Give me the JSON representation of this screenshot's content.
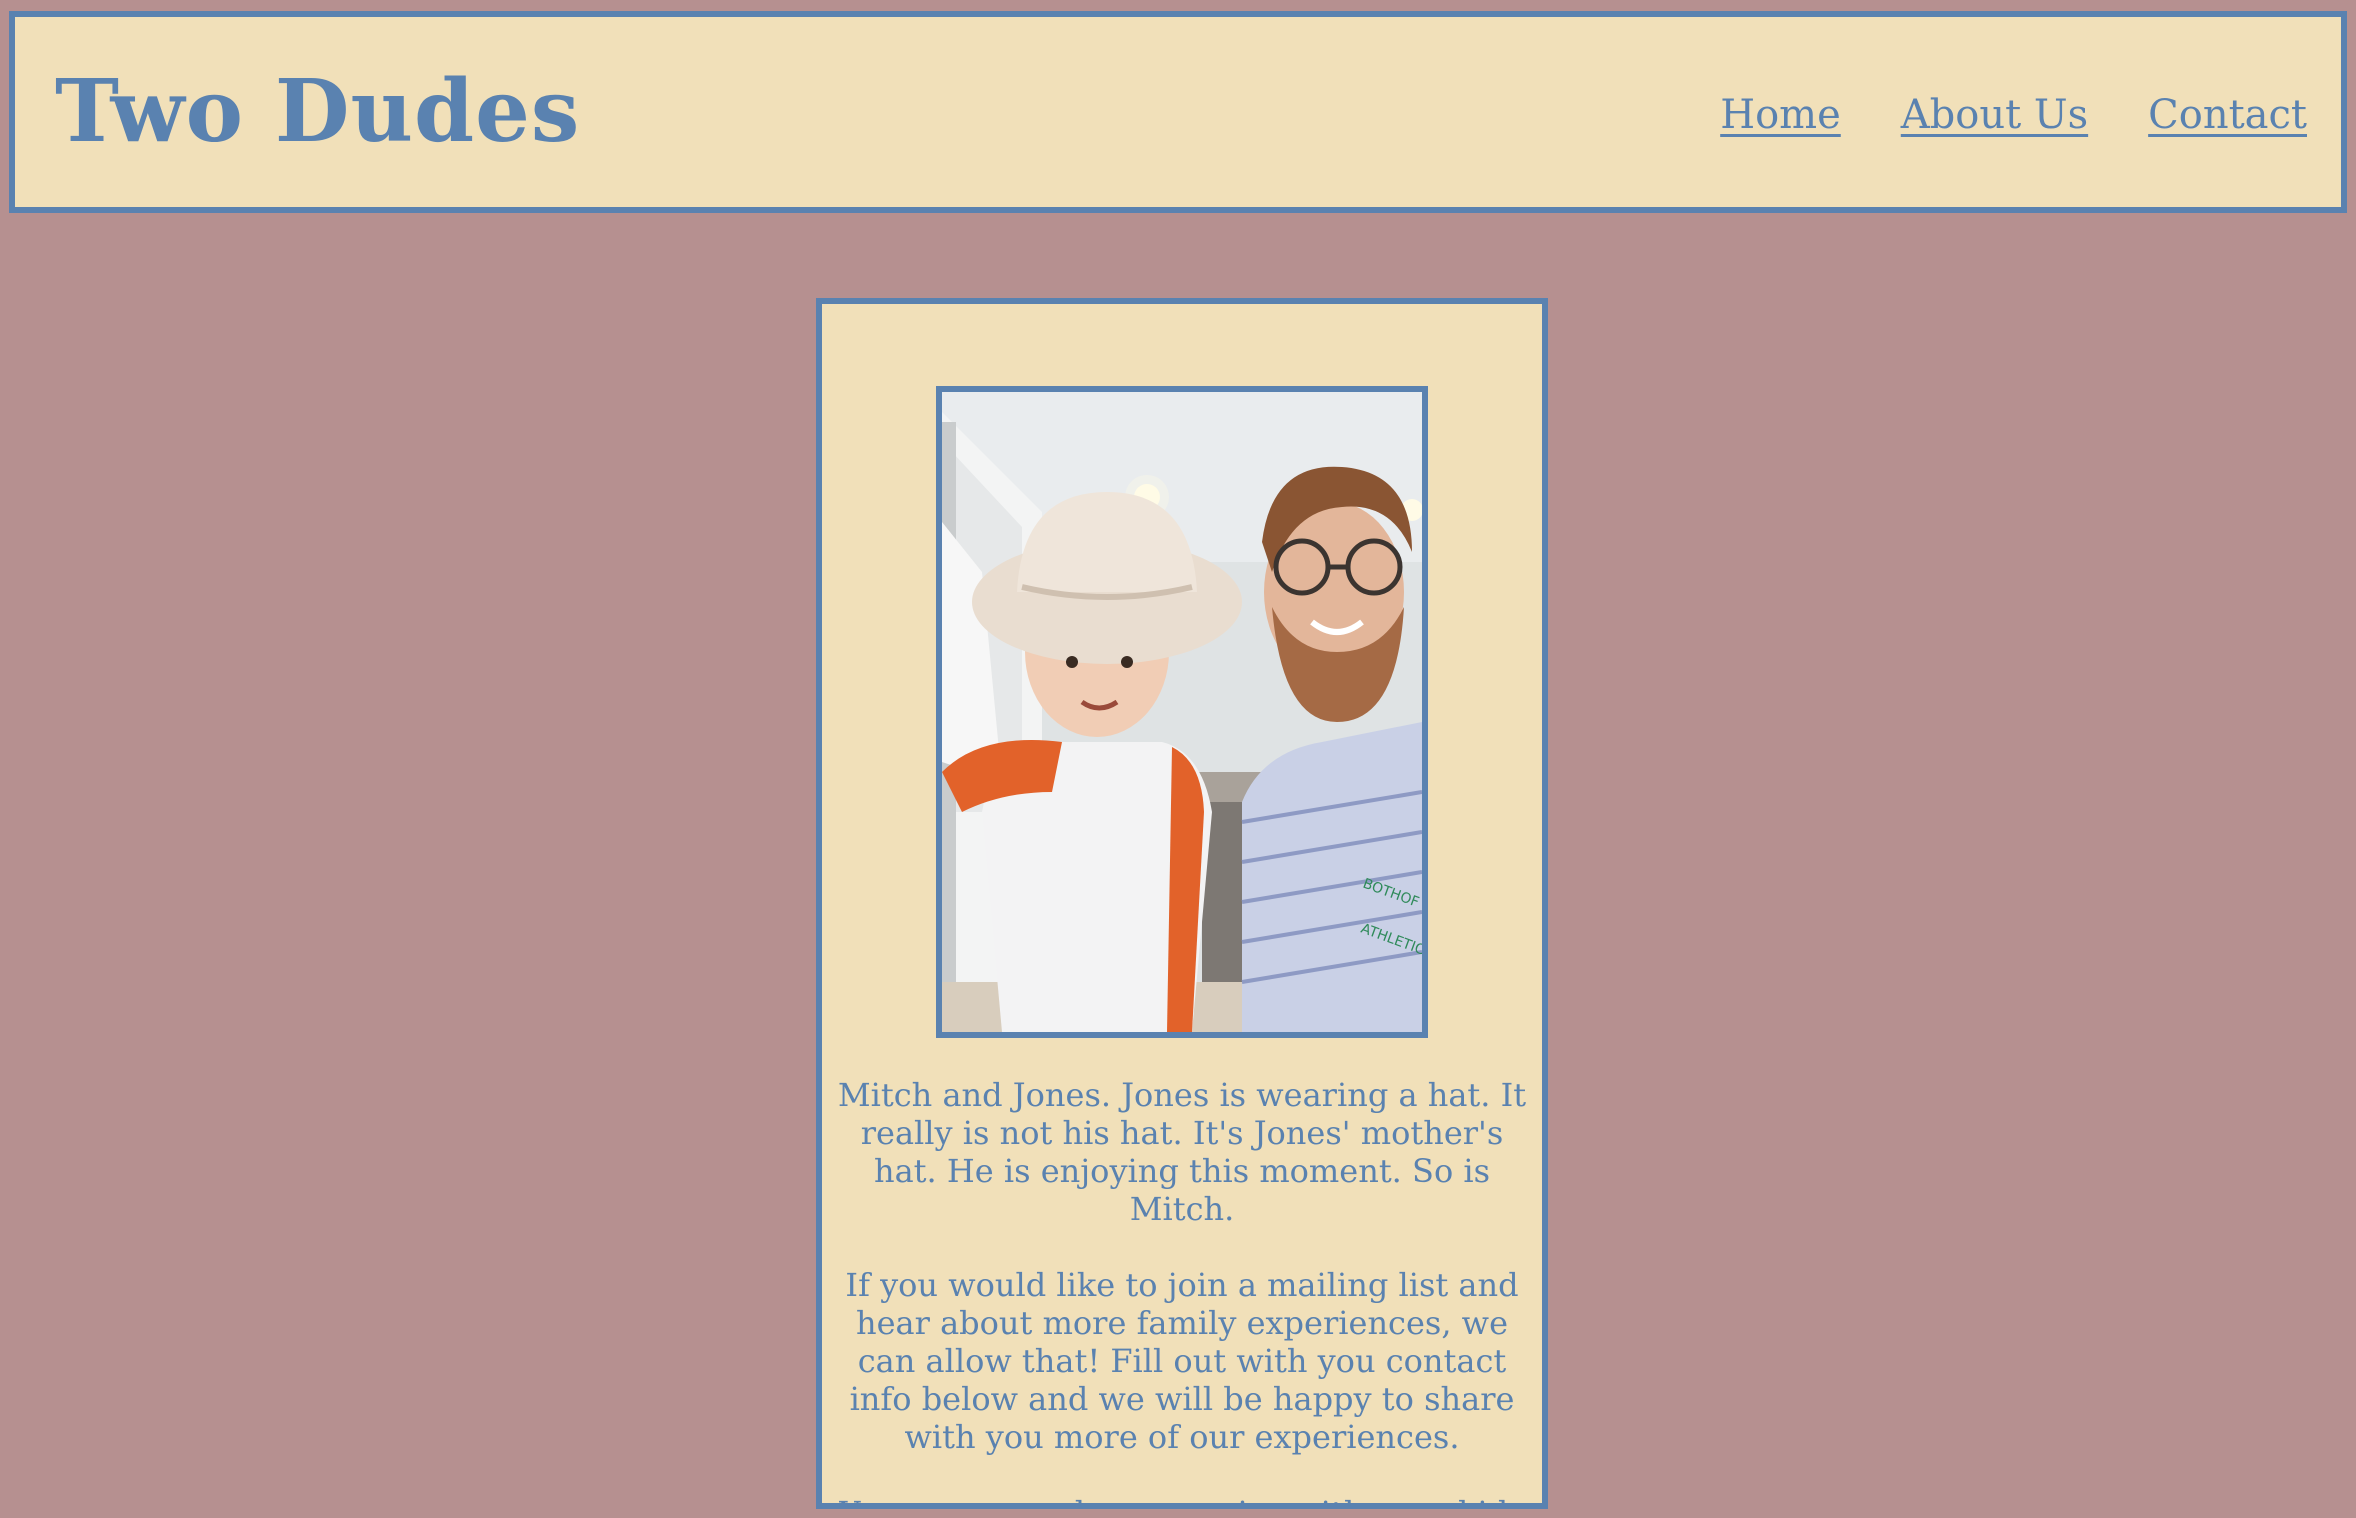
{
  "header": {
    "title": "Two Dudes",
    "nav": [
      {
        "label": "Home"
      },
      {
        "label": "About Us"
      },
      {
        "label": "Contact"
      }
    ]
  },
  "card": {
    "photo": {
      "shirt_text_1": "BOTHOF",
      "shirt_text_2": "ATHLETIC"
    },
    "paragraphs": [
      "Mitch and Jones. Jones is wearing a hat. It really is not his hat. It's Jones' mother's hat. He is enjoying this moment. So is Mitch.",
      "If you would like to join a mailing list and hear about more family experiences, we can allow that! Fill out with you contact info below and we will be happy to share with you more of our experiences.",
      "You can go make memories with your kids too."
    ]
  },
  "colors": {
    "page_background": "#b69090",
    "panel_background": "#f1e0b9",
    "accent": "#5a82b0"
  }
}
